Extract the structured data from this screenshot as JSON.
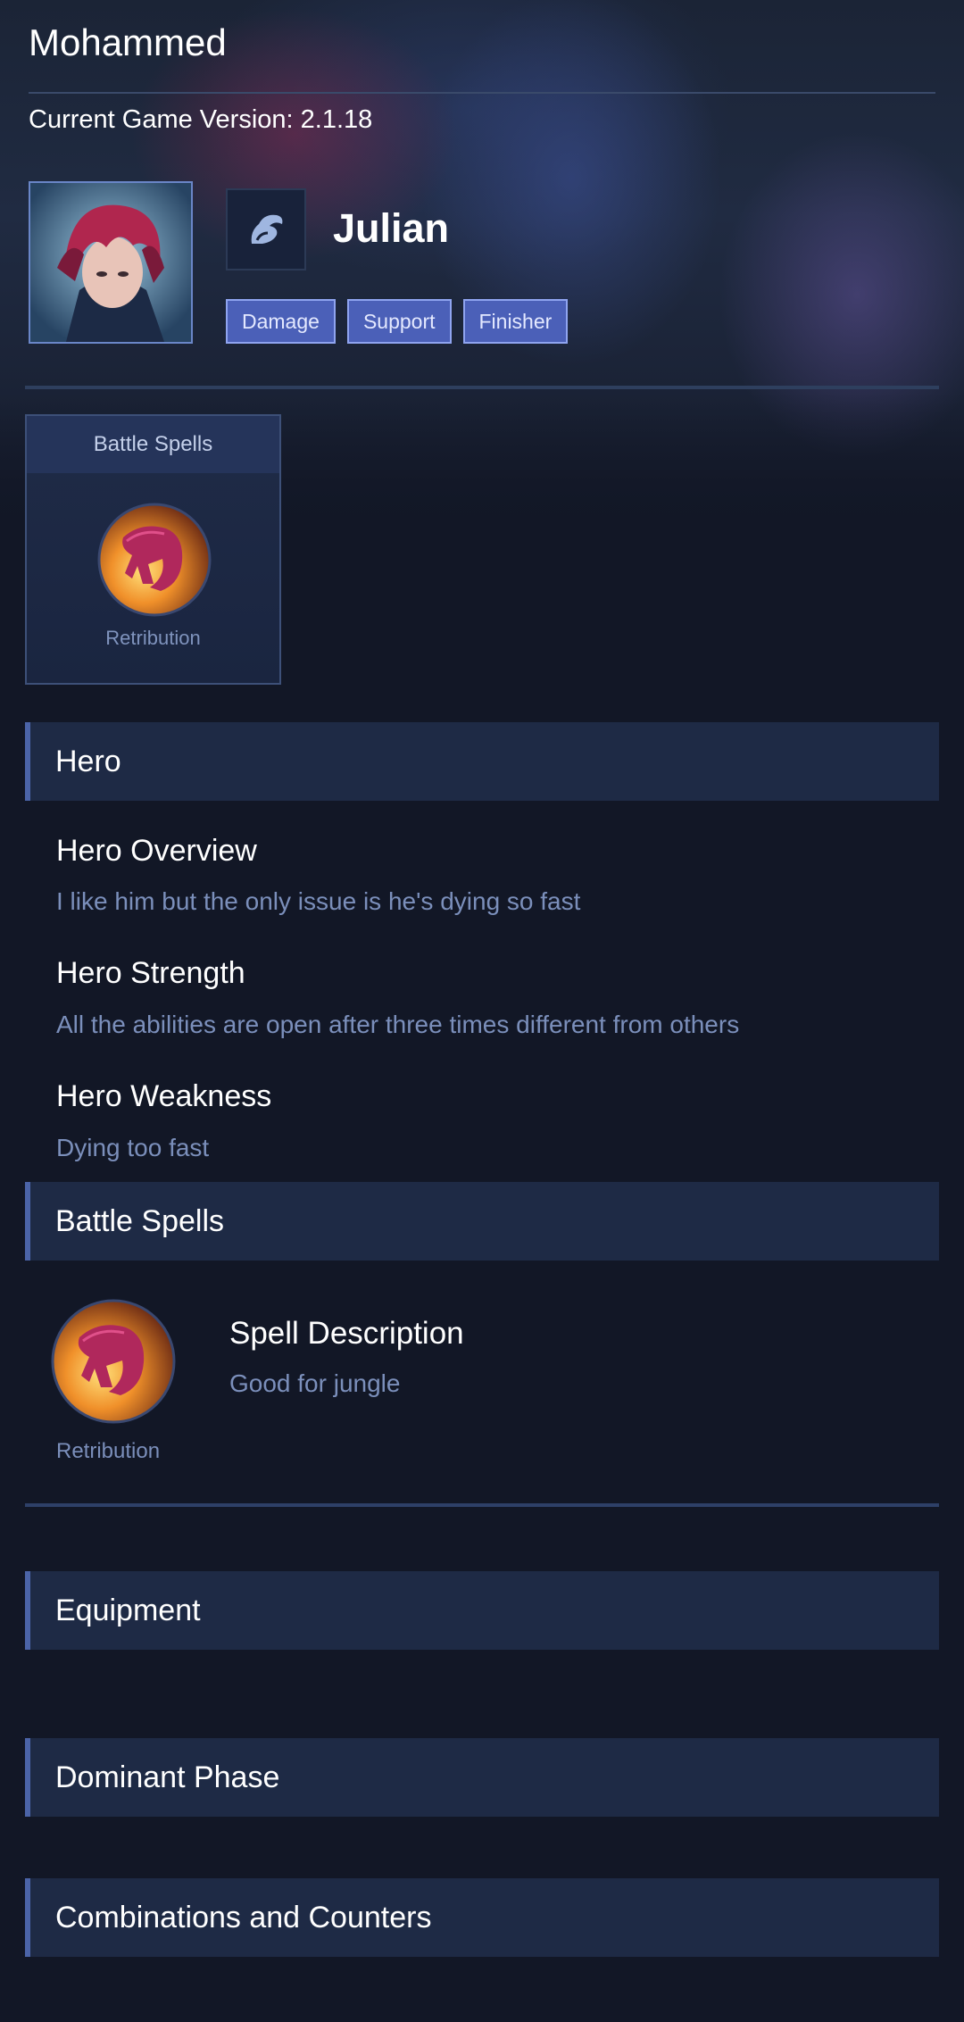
{
  "header": {
    "user_name": "Mohammed",
    "game_version": "Current Game Version: 2.1.18"
  },
  "hero": {
    "name": "Julian",
    "role_icon": "assassin-fist-icon",
    "tags": [
      "Damage",
      "Support",
      "Finisher"
    ]
  },
  "battle_spell_card": {
    "title": "Battle Spells",
    "spell_name": "Retribution",
    "spell_icon": "retribution-claw-icon"
  },
  "sections": {
    "hero": "Hero",
    "battle_spells": "Battle Spells",
    "equipment": "Equipment",
    "dominant_phase": "Dominant Phase",
    "combinations": "Combinations and Counters"
  },
  "hero_details": [
    {
      "title": "Hero Overview",
      "text": "I like him but the only issue is he's dying so fast"
    },
    {
      "title": "Hero Strength",
      "text": "All the abilities are open after three times different from others"
    },
    {
      "title": "Hero Weakness",
      "text": "Dying too fast"
    }
  ],
  "spell_detail": {
    "spell_name": "Retribution",
    "description_title": "Spell Description",
    "description_text": "Good for jungle"
  },
  "colors": {
    "background": "#121726",
    "section_bar": "#1e2a45",
    "tag_fill": "#4b60b8",
    "muted_text": "#7b8fbb"
  }
}
